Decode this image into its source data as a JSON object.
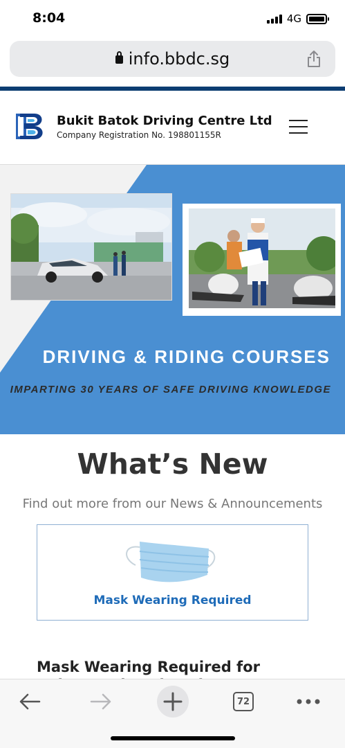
{
  "status_bar": {
    "time": "8:04",
    "network": "4G"
  },
  "browser": {
    "url": "info.bbdc.sg",
    "tab_count": "72"
  },
  "header": {
    "company_name": "Bukit Batok Driving Centre Ltd",
    "company_registration": "Company Registration No. 198801155R"
  },
  "hero": {
    "title": "DRIVING & RIDING COURSES",
    "subtitle": "IMPARTING 30 YEARS OF SAFE DRIVING KNOWLEDGE"
  },
  "whats_new": {
    "title": "What’s New",
    "subtitle": "Find out more from our News & Announcements",
    "card_caption": "Mask Wearing Required",
    "headline": "Mask Wearing Required for Indoor and Enclosed Area Settings"
  },
  "colors": {
    "brand_navy": "#0d3d72",
    "hero_blue": "#4a8fd2",
    "card_text_blue": "#1e6bb8"
  },
  "icons": [
    "lock-icon",
    "share-icon",
    "menu-icon",
    "back-icon",
    "forward-icon",
    "new-tab-icon",
    "tabs-icon",
    "more-icon"
  ]
}
